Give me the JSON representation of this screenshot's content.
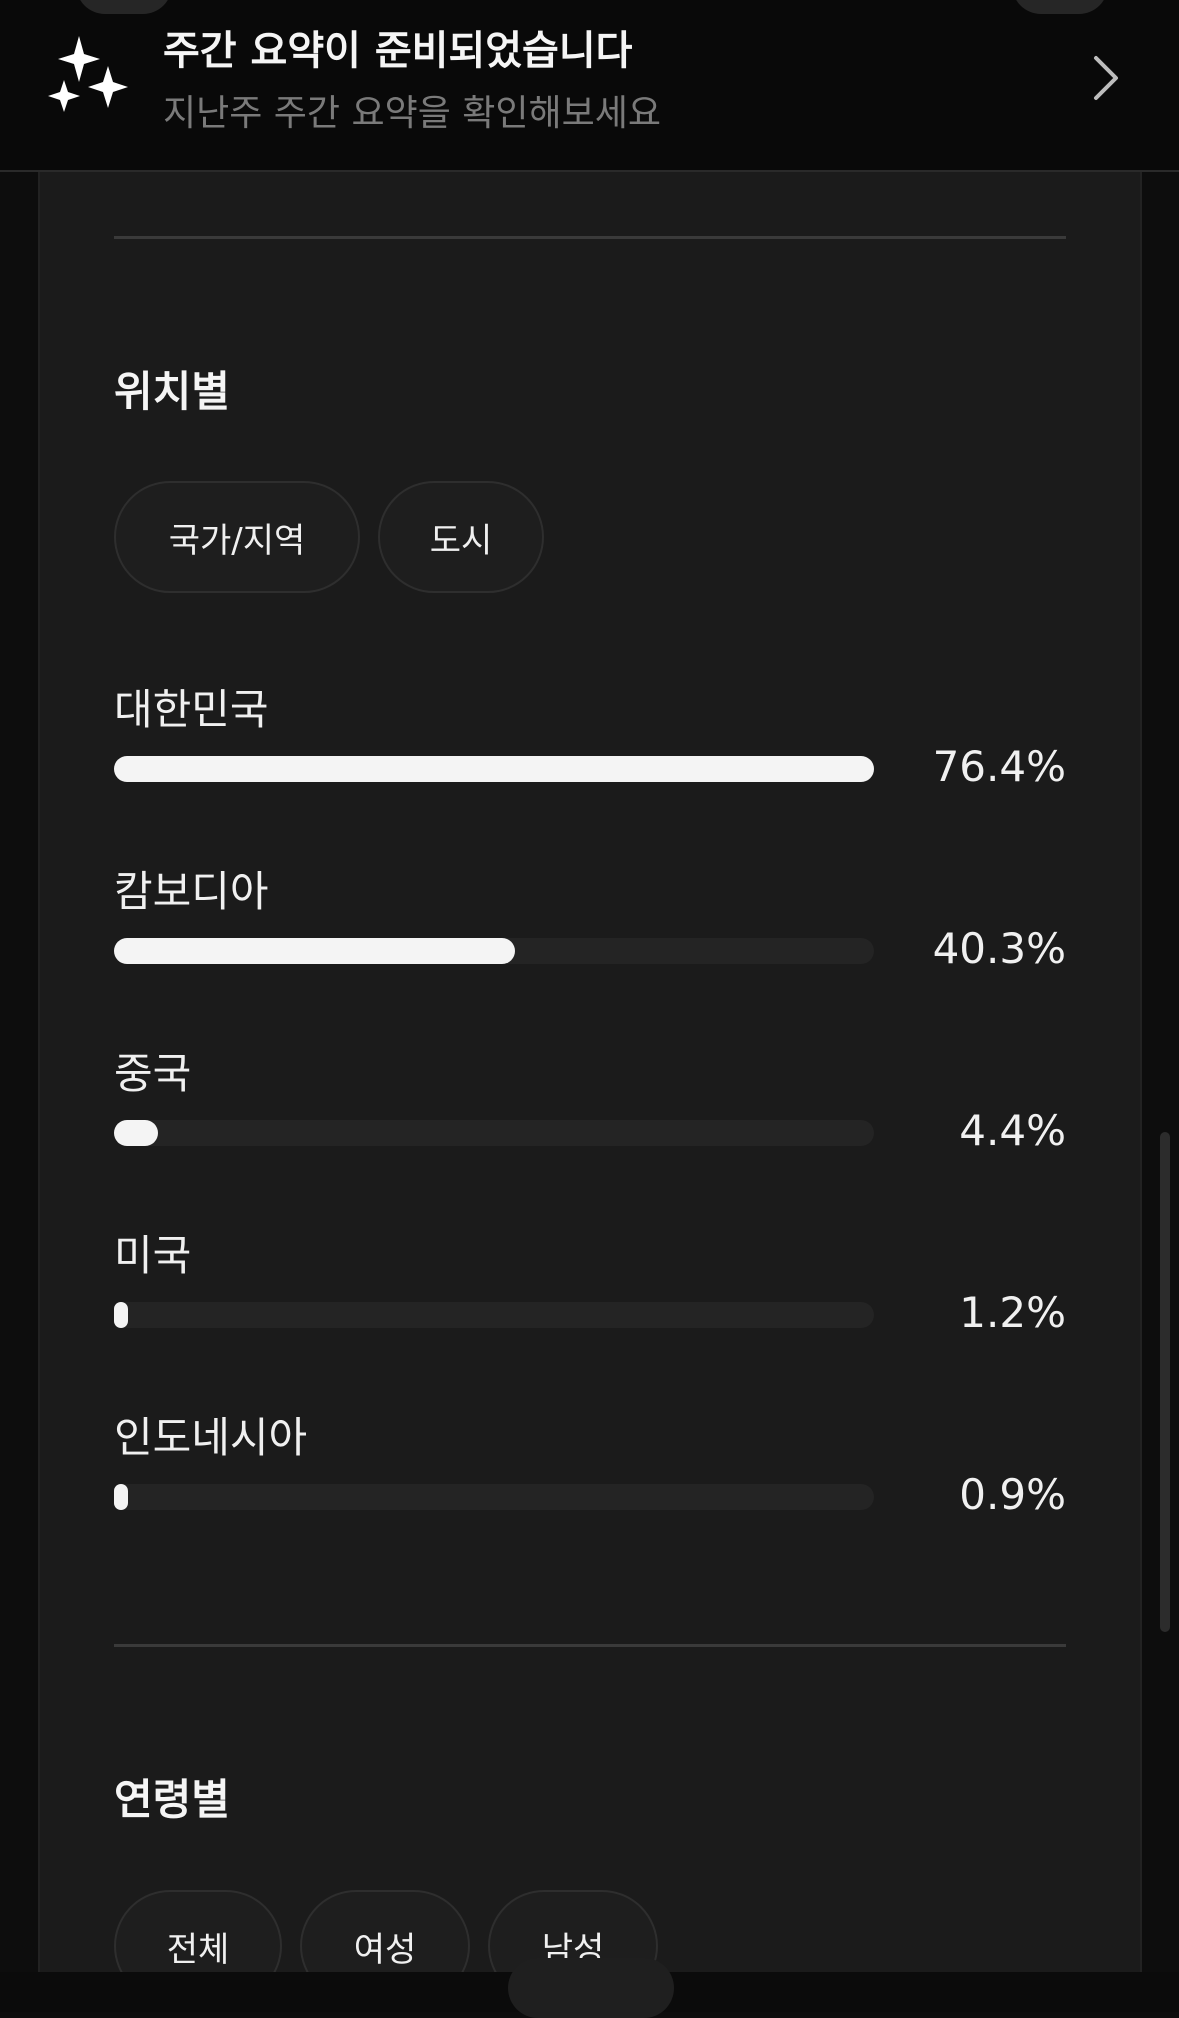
{
  "banner": {
    "icon": "sparkles-icon",
    "title": "주간 요약이 준비되었습니다",
    "subtitle": "지난주 주간 요약을 확인해보세요",
    "action_icon": "chevron-right-icon"
  },
  "location_section": {
    "title": "위치별",
    "filters": [
      {
        "label": "국가/지역",
        "selected": true
      },
      {
        "label": "도시",
        "selected": false
      }
    ],
    "rows": [
      {
        "label": "대한민국",
        "value": "76.4%",
        "fill_fraction": 1.0
      },
      {
        "label": "캄보디아",
        "value": "40.3%",
        "fill_fraction": 0.527
      },
      {
        "label": "중국",
        "value": "4.4%",
        "fill_fraction": 0.058
      },
      {
        "label": "미국",
        "value": "1.2%",
        "fill_fraction": 0.016
      },
      {
        "label": "인도네시아",
        "value": "0.9%",
        "fill_fraction": 0.012
      }
    ]
  },
  "age_section": {
    "title": "연령별",
    "filters": [
      {
        "label": "전체",
        "selected": true
      },
      {
        "label": "여성",
        "selected": false
      },
      {
        "label": "남성",
        "selected": false
      }
    ]
  },
  "colors": {
    "background": "#0d0d0d",
    "card": "#1b1b1b",
    "bar_fill": "#f4f4f4",
    "bar_track": "#242424",
    "muted_text": "#7a7a7a"
  }
}
